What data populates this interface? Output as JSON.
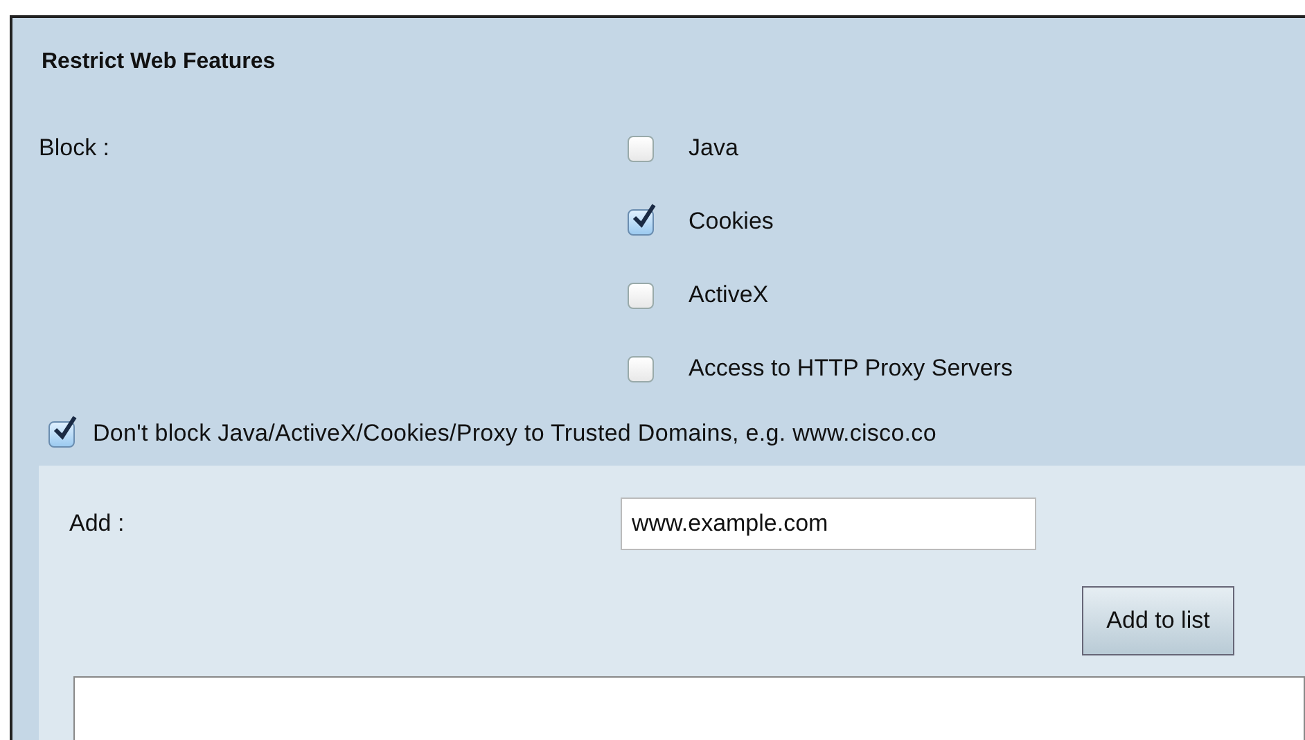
{
  "section": {
    "title": "Restrict Web Features"
  },
  "block": {
    "label": "Block :",
    "options": [
      {
        "label": "Java",
        "checked": false
      },
      {
        "label": "Cookies",
        "checked": true
      },
      {
        "label": "ActiveX",
        "checked": false
      },
      {
        "label": "Access to HTTP Proxy Servers",
        "checked": false
      }
    ]
  },
  "trusted": {
    "label": "Don't block Java/ActiveX/Cookies/Proxy to Trusted Domains, e.g. www.cisco.co",
    "checked": true
  },
  "add": {
    "label": "Add :",
    "value": "www.example.com",
    "button": "Add to list"
  }
}
